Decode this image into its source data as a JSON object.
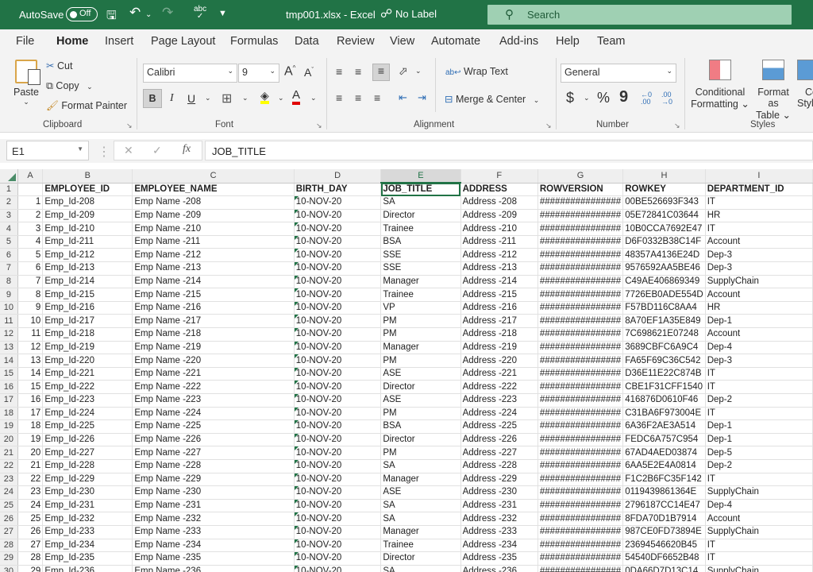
{
  "titlebar": {
    "autosave_label": "AutoSave",
    "autosave_state": "Off",
    "file_title": "tmp001.xlsx  -  Excel",
    "sensitivity_label": "No Label",
    "search_placeholder": "Search",
    "icons": [
      "save-icon",
      "undo-icon",
      "redo-icon",
      "spelling-icon",
      "customize-qat-icon"
    ]
  },
  "tabs": [
    {
      "label": "File"
    },
    {
      "label": "Home",
      "active": true
    },
    {
      "label": "Insert"
    },
    {
      "label": "Page Layout"
    },
    {
      "label": "Formulas"
    },
    {
      "label": "Data"
    },
    {
      "label": "Review"
    },
    {
      "label": "View"
    },
    {
      "label": "Automate"
    },
    {
      "label": "Add-ins"
    },
    {
      "label": "Help"
    },
    {
      "label": "Team"
    }
  ],
  "ribbon": {
    "clipboard": {
      "paste": "Paste",
      "cut": "Cut",
      "copy": "Copy",
      "format_painter": "Format Painter",
      "label": "Clipboard"
    },
    "font": {
      "name": "Calibri",
      "size": "9",
      "bold": "B",
      "italic": "I",
      "underline": "U",
      "label": "Font",
      "fill_color": "#ffff00",
      "font_color": "#e00000"
    },
    "alignment": {
      "wrap_text": "Wrap Text",
      "merge_center": "Merge & Center",
      "label": "Alignment"
    },
    "number": {
      "format": "General",
      "currency": "$",
      "percent": "%",
      "comma": "9",
      "label": "Number"
    },
    "styles": {
      "conditional": "Conditional",
      "conditional2": "Formatting",
      "format_as": "Format as",
      "table": "Table",
      "cell_styles": "Cell",
      "cell_styles2": "Styles",
      "label": "Styles"
    }
  },
  "formula_bar": {
    "name_box": "E1",
    "formula": "JOB_TITLE",
    "fx": "fx"
  },
  "sheet": {
    "columns": [
      "A",
      "B",
      "C",
      "D",
      "E",
      "F",
      "G",
      "H",
      "I"
    ],
    "selected_column": "E",
    "headers": [
      "",
      "EMPLOYEE_ID",
      "EMPLOYEE_NAME",
      "BIRTH_DAY",
      "JOB_TITLE",
      "ADDRESS",
      "ROWVERSION",
      "ROWKEY",
      "DEPARTMENT_ID"
    ],
    "rows": [
      [
        "1",
        "Emp_Id-208",
        "Emp Name -208",
        "10-NOV-20",
        "SA",
        "Address -208",
        "################",
        "00BE526693F343",
        "IT"
      ],
      [
        "2",
        "Emp_Id-209",
        "Emp Name -209",
        "10-NOV-20",
        "Director",
        "Address -209",
        "################",
        "05E72841C03644",
        "HR"
      ],
      [
        "3",
        "Emp_Id-210",
        "Emp Name -210",
        "10-NOV-20",
        "Trainee",
        "Address -210",
        "################",
        "10B0CCA7692E47",
        "IT"
      ],
      [
        "4",
        "Emp_Id-211",
        "Emp Name -211",
        "10-NOV-20",
        "BSA",
        "Address -211",
        "################",
        "D6F0332B38C14F",
        "Account"
      ],
      [
        "5",
        "Emp_Id-212",
        "Emp Name -212",
        "10-NOV-20",
        "SSE",
        "Address -212",
        "################",
        "48357A4136E24D",
        "Dep-3"
      ],
      [
        "6",
        "Emp_Id-213",
        "Emp Name -213",
        "10-NOV-20",
        "SSE",
        "Address -213",
        "################",
        "9576592AA5BE46",
        "Dep-3"
      ],
      [
        "7",
        "Emp_Id-214",
        "Emp Name -214",
        "10-NOV-20",
        "Manager",
        "Address -214",
        "################",
        "C49AE406869349",
        "SupplyChain"
      ],
      [
        "8",
        "Emp_Id-215",
        "Emp Name -215",
        "10-NOV-20",
        "Trainee",
        "Address -215",
        "################",
        "7726EB0ADE554D",
        "Account"
      ],
      [
        "9",
        "Emp_Id-216",
        "Emp Name -216",
        "10-NOV-20",
        "VP",
        "Address -216",
        "################",
        "F57BD116C8AA4",
        "HR"
      ],
      [
        "10",
        "Emp_Id-217",
        "Emp Name -217",
        "10-NOV-20",
        "PM",
        "Address -217",
        "################",
        "8A70EF1A35E849",
        "Dep-1"
      ],
      [
        "11",
        "Emp_Id-218",
        "Emp Name -218",
        "10-NOV-20",
        "PM",
        "Address -218",
        "################",
        "7C698621E07248",
        "Account"
      ],
      [
        "12",
        "Emp_Id-219",
        "Emp Name -219",
        "10-NOV-20",
        "Manager",
        "Address -219",
        "################",
        "3689CBFC6A9C4",
        "Dep-4"
      ],
      [
        "13",
        "Emp_Id-220",
        "Emp Name -220",
        "10-NOV-20",
        "PM",
        "Address -220",
        "################",
        "FA65F69C36C542",
        "Dep-3"
      ],
      [
        "14",
        "Emp_Id-221",
        "Emp Name -221",
        "10-NOV-20",
        "ASE",
        "Address -221",
        "################",
        "D36E11E22C874B",
        "IT"
      ],
      [
        "15",
        "Emp_Id-222",
        "Emp Name -222",
        "10-NOV-20",
        "Director",
        "Address -222",
        "################",
        "CBE1F31CFF1540",
        "IT"
      ],
      [
        "16",
        "Emp_Id-223",
        "Emp Name -223",
        "10-NOV-20",
        "ASE",
        "Address -223",
        "################",
        "416876D0610F46",
        "Dep-2"
      ],
      [
        "17",
        "Emp_Id-224",
        "Emp Name -224",
        "10-NOV-20",
        "PM",
        "Address -224",
        "################",
        "C31BA6F973004E",
        "IT"
      ],
      [
        "18",
        "Emp_Id-225",
        "Emp Name -225",
        "10-NOV-20",
        "BSA",
        "Address -225",
        "################",
        "6A36F2AE3A514",
        "Dep-1"
      ],
      [
        "19",
        "Emp_Id-226",
        "Emp Name -226",
        "10-NOV-20",
        "Director",
        "Address -226",
        "################",
        "FEDC6A757C954",
        "Dep-1"
      ],
      [
        "20",
        "Emp_Id-227",
        "Emp Name -227",
        "10-NOV-20",
        "PM",
        "Address -227",
        "################",
        "67AD4AED03874",
        "Dep-5"
      ],
      [
        "21",
        "Emp_Id-228",
        "Emp Name -228",
        "10-NOV-20",
        "SA",
        "Address -228",
        "################",
        "6AA5E2E4A0814",
        "Dep-2"
      ],
      [
        "22",
        "Emp_Id-229",
        "Emp Name -229",
        "10-NOV-20",
        "Manager",
        "Address -229",
        "################",
        "F1C2B6FC35F142",
        "IT"
      ],
      [
        "23",
        "Emp_Id-230",
        "Emp Name -230",
        "10-NOV-20",
        "ASE",
        "Address -230",
        "################",
        "0119439861364E",
        "SupplyChain"
      ],
      [
        "24",
        "Emp_Id-231",
        "Emp Name -231",
        "10-NOV-20",
        "SA",
        "Address -231",
        "################",
        "2796187CC14E47",
        "Dep-4"
      ],
      [
        "25",
        "Emp_Id-232",
        "Emp Name -232",
        "10-NOV-20",
        "SA",
        "Address -232",
        "################",
        "8FDA70D1B7914",
        "Account"
      ],
      [
        "26",
        "Emp_Id-233",
        "Emp Name -233",
        "10-NOV-20",
        "Manager",
        "Address -233",
        "################",
        "987CE0FD73894E",
        "SupplyChain"
      ],
      [
        "27",
        "Emp_Id-234",
        "Emp Name -234",
        "10-NOV-20",
        "Trainee",
        "Address -234",
        "################",
        "23694546620B45",
        "IT"
      ],
      [
        "28",
        "Emp_Id-235",
        "Emp Name -235",
        "10-NOV-20",
        "Director",
        "Address -235",
        "################",
        "54540DF6652B48",
        "IT"
      ],
      [
        "29",
        "Emp_Id-236",
        "Emp Name -236",
        "10-NOV-20",
        "SA",
        "Address -236",
        "################",
        "0DA66D7D13C14",
        "SupplyChain"
      ]
    ]
  }
}
